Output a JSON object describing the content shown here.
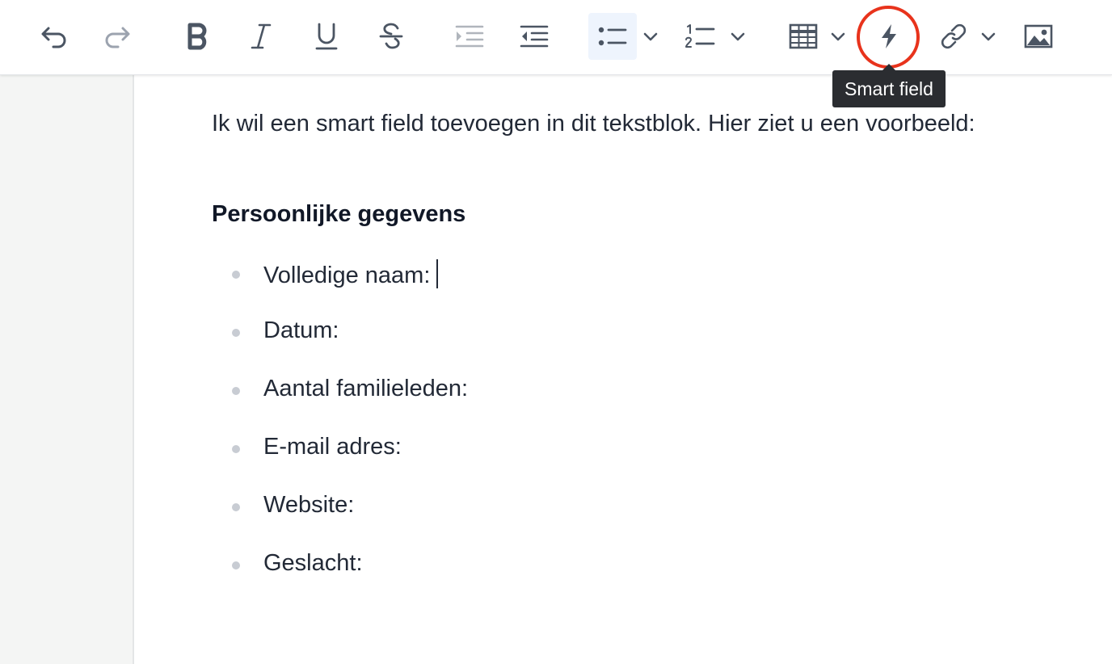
{
  "toolbar": {
    "buttons": [
      {
        "name": "undo-icon",
        "label": "Undo"
      },
      {
        "name": "redo-icon",
        "label": "Redo",
        "disabled": true
      },
      {
        "name": "bold-icon"
      },
      {
        "name": "italic-icon"
      },
      {
        "name": "underline-icon"
      },
      {
        "name": "strikethrough-icon"
      },
      {
        "name": "indent-icon",
        "disabled": true
      },
      {
        "name": "outdent-icon"
      },
      {
        "name": "bulleted-list-icon",
        "active": true
      },
      {
        "name": "numbered-list-icon"
      },
      {
        "name": "table-icon"
      },
      {
        "name": "lightning-icon"
      },
      {
        "name": "link-icon"
      },
      {
        "name": "image-icon"
      }
    ],
    "tooltip": "Smart field"
  },
  "editor": {
    "intro": "Ik wil een smart field toevoegen in dit tekstblok. Hier ziet u een voorbeeld:",
    "heading": "Persoonlijke gegevens",
    "items": [
      {
        "label": "Volledige naam:"
      },
      {
        "label": "Datum:"
      },
      {
        "label": "Aantal familieleden:"
      },
      {
        "label": "E-mail adres:"
      },
      {
        "label": "Website:"
      },
      {
        "label": "Geslacht:"
      }
    ]
  },
  "colors": {
    "highlight_ring": "#e8331c",
    "icon": "#4b5563",
    "icon_disabled": "#9ca3af",
    "active_bg": "#eef4fd",
    "sidebar_bg": "#f4f5f4",
    "tooltip_bg": "#2b2d31"
  }
}
